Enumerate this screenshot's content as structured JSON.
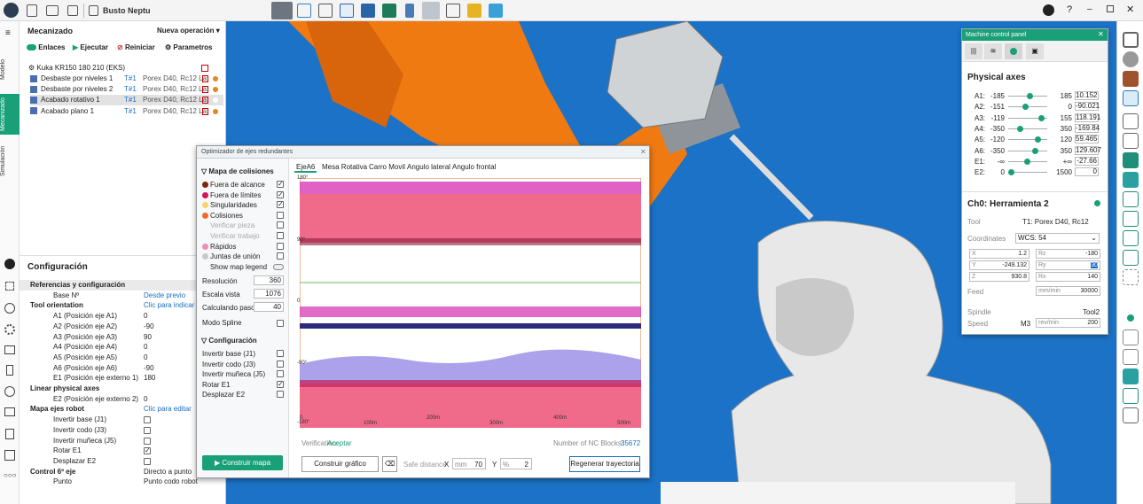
{
  "app": {
    "title": "Busto Neptu"
  },
  "left_tabs": [
    "Modelo",
    "Mecanizado",
    "Simulación"
  ],
  "mecanizado": {
    "title": "Mecanizado",
    "new_op": "Nueva operación",
    "links_label": "Enlaces",
    "run_label": "Ejecutar",
    "reset_label": "Reiniciar",
    "params_label": "Parametros",
    "robot": "Kuka KR150 180 210 (EKS)",
    "ops": [
      {
        "name": "Desbaste por niveles 1",
        "tool": "T#1",
        "desc": "Porex D40, Rc12 La:"
      },
      {
        "name": "Desbaste por niveles 2",
        "tool": "T#1",
        "desc": "Porex D40, Rc12 La:"
      },
      {
        "name": "Acabado rotativo 1",
        "tool": "T#1",
        "desc": "Porex D40, Rc12 La:"
      },
      {
        "name": "Acabado plano 1",
        "tool": "T#1",
        "desc": "Porex D40, Rc12 La:"
      }
    ]
  },
  "config": {
    "title": "Configuración",
    "rows": [
      {
        "label": "Referencias y configuración",
        "value": "",
        "bold": true,
        "indent": 0
      },
      {
        "label": "Base Nº",
        "value": "Desde previo",
        "link": true,
        "indent": 2
      },
      {
        "label": "Tool orientation",
        "value": "Clic para indicar",
        "bold": true,
        "link": true,
        "indent": 0
      },
      {
        "label": "A1 (Posición eje A1)",
        "value": "0",
        "indent": 2
      },
      {
        "label": "A2 (Posición eje A2)",
        "value": "-90",
        "indent": 2
      },
      {
        "label": "A3 (Posición eje A3)",
        "value": "90",
        "indent": 2
      },
      {
        "label": "A4 (Posición eje A4)",
        "value": "0",
        "indent": 2
      },
      {
        "label": "A5 (Posición eje A5)",
        "value": "0",
        "indent": 2
      },
      {
        "label": "A6 (Posición eje A6)",
        "value": "-90",
        "indent": 2
      },
      {
        "label": "E1 (Posición eje externo 1)",
        "value": "180",
        "indent": 2
      },
      {
        "label": "Linear physical axes",
        "value": "",
        "bold": true,
        "indent": 0
      },
      {
        "label": "E2 (Posición eje externo 2)",
        "value": "0",
        "indent": 2
      },
      {
        "label": "Mapa ejes robot",
        "value": "Clic para editar",
        "bold": true,
        "link": true,
        "indent": 0
      },
      {
        "label": "Invertir base (J1)",
        "value": "",
        "chk": false,
        "indent": 2
      },
      {
        "label": "Invertir codo (J3)",
        "value": "",
        "chk": false,
        "indent": 2
      },
      {
        "label": "Invertir muñeca (J5)",
        "value": "",
        "chk": false,
        "indent": 2
      },
      {
        "label": "Rotar E1",
        "value": "",
        "chk": true,
        "indent": 2
      },
      {
        "label": "Desplazar E2",
        "value": "",
        "chk": false,
        "indent": 2
      },
      {
        "label": "Control 6º eje",
        "value": "Directo a punto",
        "bold": true,
        "indent": 0
      },
      {
        "label": "Punto",
        "value": "Punto codo robot",
        "indent": 2
      }
    ]
  },
  "optimizer": {
    "title": "Optimizador de ejes redundantes",
    "map_title": "Mapa de colisiones",
    "map_items": [
      {
        "label": "Fuera de alcance",
        "color": "#7b2a12",
        "chk": true
      },
      {
        "label": "Fuera de límites",
        "color": "#d4145a",
        "chk": true
      },
      {
        "label": "Singularidades",
        "color": "#f5d36b",
        "chk": true
      },
      {
        "label": "Colisiones",
        "color": "#ef6a2b",
        "chk": false
      },
      {
        "label": "Verificar pieza",
        "color": "",
        "chk": false,
        "disabled": true
      },
      {
        "label": "Verificar trabajo",
        "color": "",
        "chk": false,
        "disabled": true
      },
      {
        "label": "Rápidos",
        "color": "#e88fb5",
        "chk": false
      },
      {
        "label": "Juntas de unión",
        "color": "#c9c9c9",
        "chk": false
      },
      {
        "label": "Show map legend",
        "color": "",
        "toggle": true
      }
    ],
    "params": [
      {
        "label": "Resolución",
        "value": "360"
      },
      {
        "label": "Escala vista",
        "value": "1076"
      },
      {
        "label": "Calculando paso (m",
        "value": "40"
      }
    ],
    "spline_label": "Modo Spline",
    "config_title": "Configuración",
    "config_items": [
      {
        "label": "Invertir base (J1)",
        "chk": false
      },
      {
        "label": "Invertir codo (J3)",
        "chk": false
      },
      {
        "label": "Invertir muñeca (J5)",
        "chk": false
      },
      {
        "label": "Rotar E1",
        "chk": true
      },
      {
        "label": "Desplazar E2",
        "chk": false
      }
    ],
    "build_map": "Construir mapa",
    "tabs": [
      "EjeA6",
      "Mesa Rotativa",
      "Carro Movil",
      "Angulo lateral",
      "Angulo frontal"
    ],
    "y_ticks": [
      "180°",
      "90°",
      "0",
      "-90°",
      "-180°"
    ],
    "x_ticks": [
      "0",
      "100m",
      "200m",
      "300m",
      "400m",
      "500m"
    ],
    "verification_label": "Verification:",
    "verification_value": "Aceptar",
    "nc_label": "Number of NC Blocks:",
    "nc_value": "35672",
    "build_graph": "Construir gráfico",
    "safe_label": "Safe distance",
    "x_label": "X",
    "x_unit": "mm",
    "x_value": "70",
    "y_label": "Y",
    "y_unit": "%",
    "y_value": "2",
    "regen": "Regenerar trayectoria"
  },
  "mcp": {
    "title": "Machine control panel",
    "physical_axes": "Physical axes",
    "axes": [
      {
        "name": "A1:",
        "min": "-185",
        "max": "185",
        "val": "10.152",
        "pos": 0.53
      },
      {
        "name": "A2:",
        "min": "-151",
        "max": "0",
        "val": "-90.021",
        "pos": 0.4
      },
      {
        "name": "A3:",
        "min": "-119",
        "max": "155",
        "val": "118.191",
        "pos": 0.86
      },
      {
        "name": "A4:",
        "min": "-350",
        "max": "350",
        "val": "-169.84",
        "pos": 0.26
      },
      {
        "name": "A5:",
        "min": "-120",
        "max": "120",
        "val": "59.465",
        "pos": 0.75
      },
      {
        "name": "A6:",
        "min": "-350",
        "max": "350",
        "val": "129.607",
        "pos": 0.68
      },
      {
        "name": "E1:",
        "min": "-∞",
        "max": "+∞",
        "val": "-27.66",
        "pos": 0.45
      },
      {
        "name": "E2:",
        "min": "0",
        "max": "1500",
        "val": "0",
        "pos": 0.0
      }
    ],
    "channel": "Ch0: Herramienta 2",
    "tool_label": "Tool",
    "tool_value": "T1: Porex D40, Rc12",
    "coords_label": "Coordinates",
    "coords_value": "WCS: 54",
    "x": "1.2",
    "y": "-249.132",
    "z": "930.8",
    "rz": "-180",
    "ry": "30",
    "rx": "140",
    "feed_label": "Feed",
    "feed_unit": "mm/min",
    "feed_value": "30000",
    "spindle_label": "Spindle",
    "spindle_value": "Tool2",
    "speed_label": "Speed",
    "speed_code": "M3",
    "speed_unit": "rev/min",
    "speed_value": "200"
  },
  "colors": {
    "viewport": "#1b72c6",
    "robot": "#f07a12",
    "accent": "#1aa078"
  }
}
